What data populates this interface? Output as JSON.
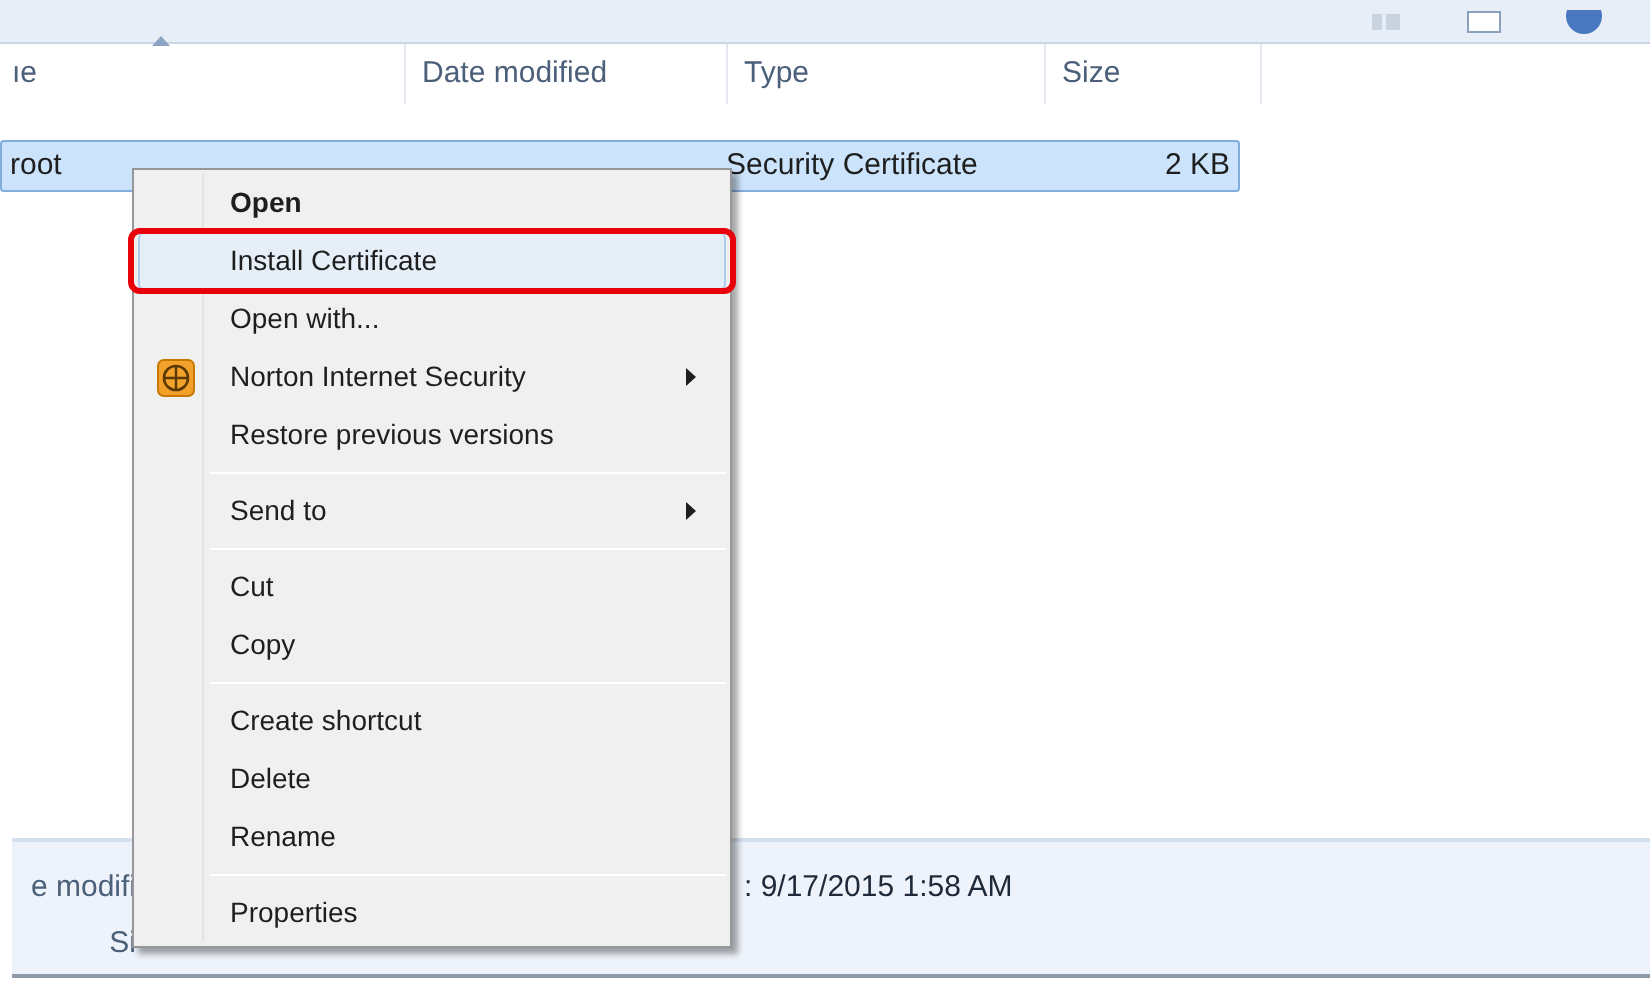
{
  "columns": [
    {
      "label": "ıe",
      "sorted": true
    },
    {
      "label": "Date modified",
      "sorted": false
    },
    {
      "label": "Type",
      "sorted": false
    },
    {
      "label": "Size",
      "sorted": false
    }
  ],
  "files": [
    {
      "name": "root",
      "type": "Security Certificate",
      "size": "2 KB",
      "selected": true
    }
  ],
  "context_menu": [
    {
      "kind": "item",
      "label": "Open",
      "bold": true,
      "highlighted": false,
      "submenu": false,
      "icon": false
    },
    {
      "kind": "item",
      "label": "Install Certificate",
      "bold": false,
      "highlighted": true,
      "submenu": false,
      "icon": false
    },
    {
      "kind": "item",
      "label": "Open with...",
      "bold": false,
      "highlighted": false,
      "submenu": false,
      "icon": false
    },
    {
      "kind": "item",
      "label": "Norton Internet Security",
      "bold": false,
      "highlighted": false,
      "submenu": true,
      "icon": true
    },
    {
      "kind": "item",
      "label": "Restore previous versions",
      "bold": false,
      "highlighted": false,
      "submenu": false,
      "icon": false
    },
    {
      "kind": "separator"
    },
    {
      "kind": "item",
      "label": "Send to",
      "bold": false,
      "highlighted": false,
      "submenu": true,
      "icon": false
    },
    {
      "kind": "separator"
    },
    {
      "kind": "item",
      "label": "Cut",
      "bold": false,
      "highlighted": false,
      "submenu": false,
      "icon": false
    },
    {
      "kind": "item",
      "label": "Copy",
      "bold": false,
      "highlighted": false,
      "submenu": false,
      "icon": false
    },
    {
      "kind": "separator"
    },
    {
      "kind": "item",
      "label": "Create shortcut",
      "bold": false,
      "highlighted": false,
      "submenu": false,
      "icon": false
    },
    {
      "kind": "item",
      "label": "Delete",
      "bold": false,
      "highlighted": false,
      "submenu": false,
      "icon": false
    },
    {
      "kind": "item",
      "label": "Rename",
      "bold": false,
      "highlighted": false,
      "submenu": false,
      "icon": false
    },
    {
      "kind": "separator"
    },
    {
      "kind": "item",
      "label": "Properties",
      "bold": false,
      "highlighted": false,
      "submenu": false,
      "icon": false
    }
  ],
  "details": {
    "labels": [
      "e modifi",
      "Si"
    ],
    "value": ": 9/17/2015 1:58 AM"
  }
}
